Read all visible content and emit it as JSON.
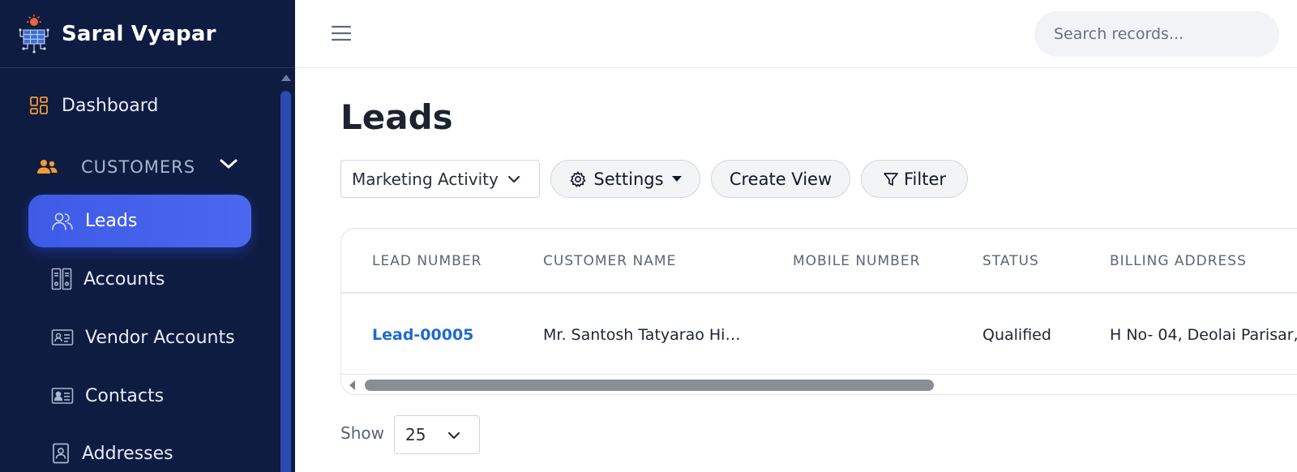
{
  "app": {
    "name": "Saral Vyapar"
  },
  "sidebar": {
    "dashboard": "Dashboard",
    "section": "CUSTOMERS",
    "items": [
      {
        "label": "Leads",
        "active": true,
        "icon": "users-icon"
      },
      {
        "label": "Accounts",
        "active": false,
        "icon": "binders-icon"
      },
      {
        "label": "Vendor Accounts",
        "active": false,
        "icon": "id-card-icon"
      },
      {
        "label": "Contacts",
        "active": false,
        "icon": "contact-card-icon"
      },
      {
        "label": "Addresses",
        "active": false,
        "icon": "address-book-icon"
      }
    ]
  },
  "header": {
    "search_placeholder": "Search records..."
  },
  "page": {
    "title": "Leads",
    "view_select": "Marketing Activity",
    "settings_label": "Settings",
    "create_view_label": "Create View",
    "filter_label": "Filter"
  },
  "table": {
    "columns": [
      "LEAD NUMBER",
      "CUSTOMER NAME",
      "MOBILE NUMBER",
      "STATUS",
      "BILLING ADDRESS"
    ],
    "rows": [
      {
        "lead_number": "Lead-00005",
        "customer_name": "Mr. Santosh Tatyarao Hi…",
        "mobile_number": "",
        "status": "Qualified",
        "billing_address": "H No- 04, Deolai Parisar,…"
      }
    ]
  },
  "pagination": {
    "show_label": "Show",
    "page_size": "25"
  },
  "colors": {
    "sidebar_bg": "#0f1c42",
    "active_item": "#4360ea",
    "link": "#1f6bd1",
    "accent_orange": "#f39a33"
  }
}
